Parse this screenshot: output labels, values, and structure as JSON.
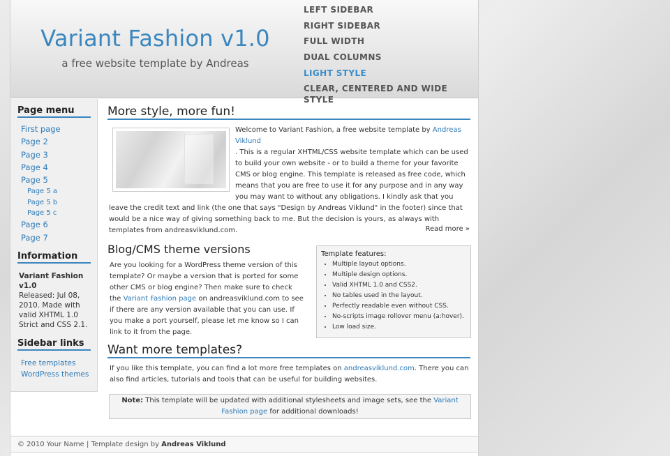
{
  "header": {
    "title": "Variant Fashion v1.0",
    "slogan": "a free website template by Andreas",
    "style_menu": [
      {
        "label": "LEFT SIDEBAR"
      },
      {
        "label": "RIGHT SIDEBAR"
      },
      {
        "label": "FULL WIDTH"
      },
      {
        "label": "DUAL COLUMNS"
      },
      {
        "label": "LIGHT STYLE",
        "active": true
      },
      {
        "label": "CLEAR, CENTERED AND WIDE STYLE"
      }
    ]
  },
  "sidebar": {
    "page_menu_heading": "Page menu",
    "page_menu": [
      {
        "label": "First page"
      },
      {
        "label": "Page 2"
      },
      {
        "label": "Page 3"
      },
      {
        "label": "Page 4"
      },
      {
        "label": "Page 5"
      },
      {
        "label": "Page 5 a",
        "sub": true
      },
      {
        "label": "Page 5 b",
        "sub": true
      },
      {
        "label": "Page 5 c",
        "sub": true
      },
      {
        "label": "Page 6"
      },
      {
        "label": "Page 7"
      }
    ],
    "info_heading": "Information",
    "info_title": "Variant Fashion v1.0",
    "info_text": "Released: Jul 08, 2010. Made with valid XHTML 1.0 Strict and CSS 2.1.",
    "links_heading": "Sidebar links",
    "links": [
      {
        "label": "Free templates"
      },
      {
        "label": "WordPress themes"
      }
    ]
  },
  "main": {
    "section1": {
      "heading": "More style, more fun!",
      "intro_before": "Welcome to Variant Fashion, a free website template by ",
      "intro_link": "Andreas Viklund",
      "intro_after": ". This is a regular XHTML/CSS website template which can be used to build your own website - or to build a theme for your favorite CMS or blog engine. This template is released as free code, which means that you are free to use it for any purpose and in any way you may want to without any obligations. I kindly ask that you leave the credit text and link (the one that says \"Design by Andreas Viklund\" in the footer) since that would be a nice way of giving something back to me. But the decision is yours, as always with templates from andreasviklund.com.",
      "read_more": "Read more »"
    },
    "section2": {
      "heading": "Blog/CMS theme versions",
      "text_before": "Are you looking for a WordPress theme version of this template? Or maybe a version that is ported for some other CMS or blog engine? Then make sure to check the ",
      "link": "Variant Fashion page",
      "text_after": " on andreasviklund.com to see if there are any version available that you can use. If you make a port yourself, please let me know so I can link to it from the page."
    },
    "features": {
      "title": "Template features:",
      "items": [
        "Multiple layout options.",
        "Multiple design options.",
        "Valid XHTML 1.0 and CSS2.",
        "No tables used in the layout.",
        "Perfectly readable even without CSS.",
        "No-scripts image rollover menu (a:hover).",
        "Low load size."
      ]
    },
    "section3": {
      "heading": "Want more templates?",
      "text_before": "If you like this template, you can find a lot more free templates on ",
      "link": "andreasviklund.com",
      "text_after": ". There you can also find articles, tutorials and tools that can be useful for building websites."
    },
    "note": {
      "label": "Note:",
      "text_before": " This template will be updated with additional stylesheets and image sets, see the ",
      "link": "Variant Fashion page",
      "text_after": " for additional downloads!"
    }
  },
  "footer": {
    "text": "© 2010 Your Name | Template design by ",
    "author": "Andreas Viklund"
  }
}
